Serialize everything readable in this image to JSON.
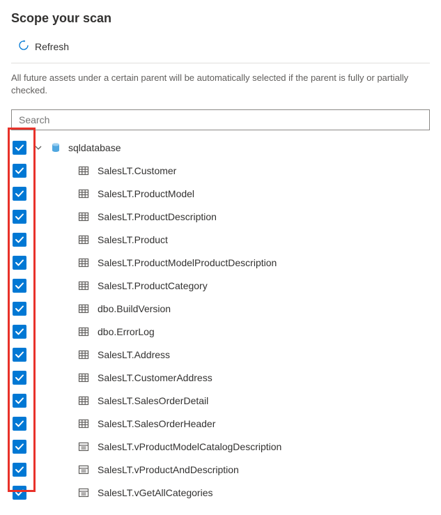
{
  "title": "Scope your scan",
  "toolbar": {
    "refresh_label": "Refresh"
  },
  "description": "All future assets under a certain parent will be automatically selected if the parent is fully or partially checked.",
  "search": {
    "placeholder": "Search",
    "value": ""
  },
  "tree": {
    "root_label": "sqldatabase",
    "items": [
      {
        "label": "SalesLT.Customer",
        "icon": "table"
      },
      {
        "label": "SalesLT.ProductModel",
        "icon": "table"
      },
      {
        "label": "SalesLT.ProductDescription",
        "icon": "table"
      },
      {
        "label": "SalesLT.Product",
        "icon": "table"
      },
      {
        "label": "SalesLT.ProductModelProductDescription",
        "icon": "table"
      },
      {
        "label": "SalesLT.ProductCategory",
        "icon": "table"
      },
      {
        "label": "dbo.BuildVersion",
        "icon": "table"
      },
      {
        "label": "dbo.ErrorLog",
        "icon": "table"
      },
      {
        "label": "SalesLT.Address",
        "icon": "table"
      },
      {
        "label": "SalesLT.CustomerAddress",
        "icon": "table"
      },
      {
        "label": "SalesLT.SalesOrderDetail",
        "icon": "table"
      },
      {
        "label": "SalesLT.SalesOrderHeader",
        "icon": "table"
      },
      {
        "label": "SalesLT.vProductModelCatalogDescription",
        "icon": "view"
      },
      {
        "label": "SalesLT.vProductAndDescription",
        "icon": "view"
      },
      {
        "label": "SalesLT.vGetAllCategories",
        "icon": "view"
      }
    ]
  }
}
